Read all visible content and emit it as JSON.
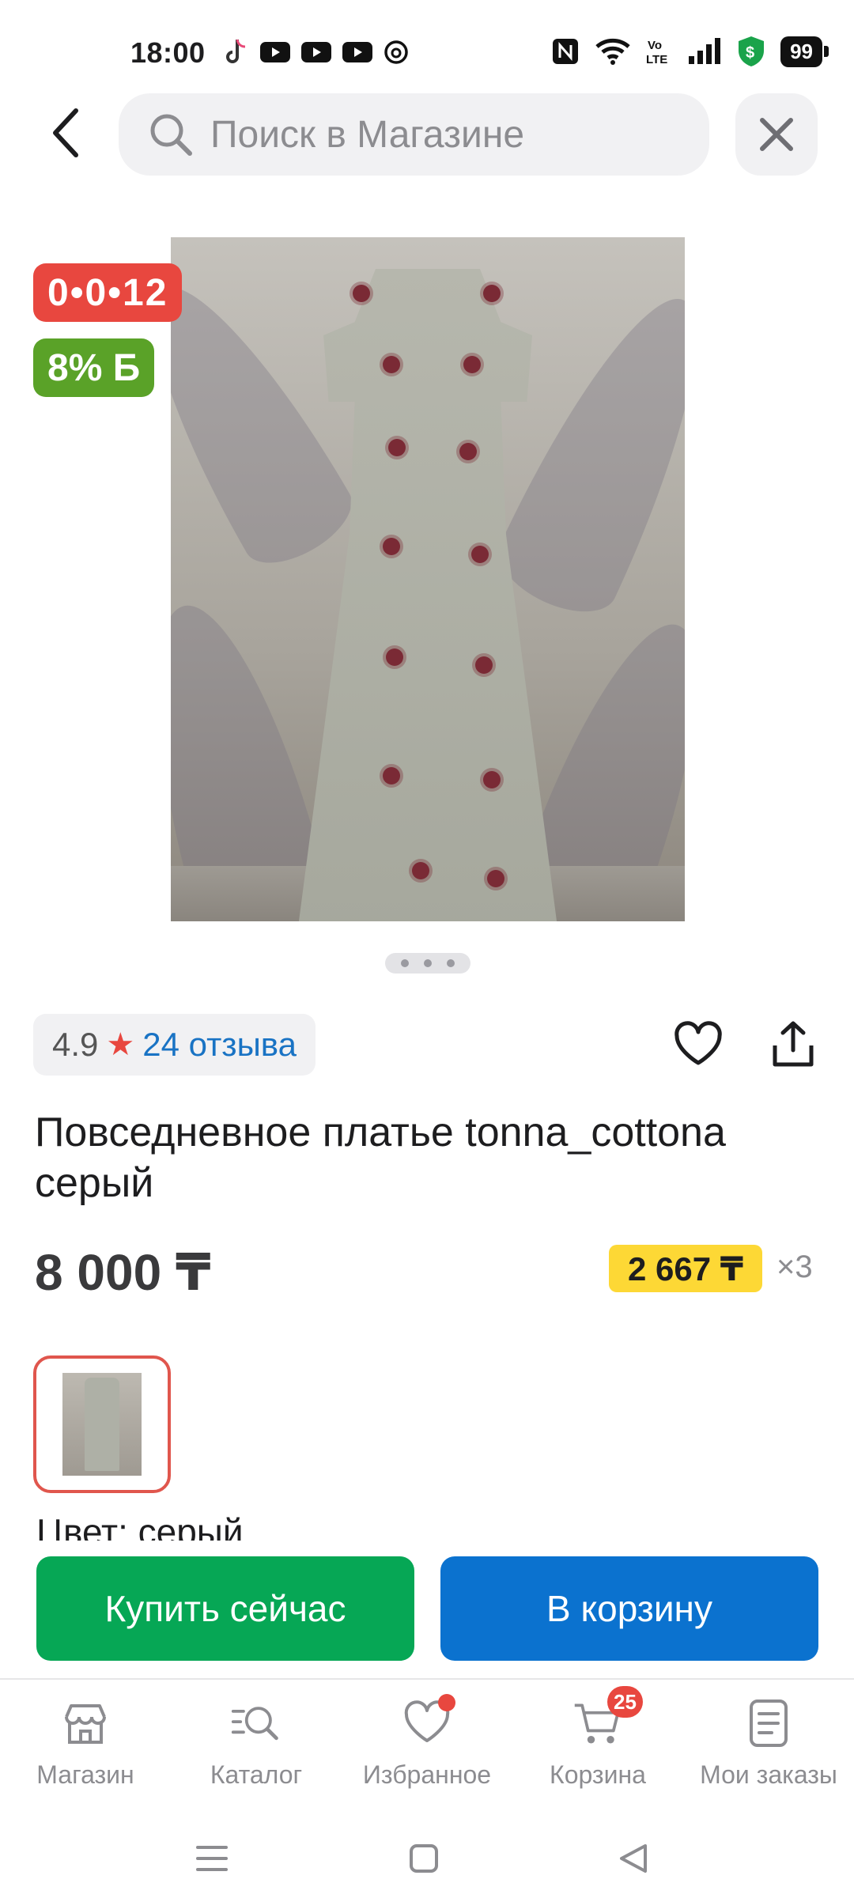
{
  "status_bar": {
    "time": "18:00",
    "battery": "99",
    "app_icons": [
      "tiktok-icon",
      "youtube-icon",
      "youtube-icon",
      "youtube-icon",
      "threads-icon"
    ],
    "right_icons": [
      "nfc-icon",
      "wifi-icon",
      "volte-icon",
      "signal-icon",
      "shield-dollar-icon",
      "battery-icon"
    ]
  },
  "header": {
    "search_placeholder": "Поиск в Магазине"
  },
  "product": {
    "timer": "0•0•12",
    "bonus": "8% Б",
    "image_count": 3,
    "active_image": 1,
    "rating": "4.9",
    "reviews": "24 отзыва",
    "title": "Повседневное платье tonna_cottona серый",
    "price": "8 000 ₸",
    "installment_price": "2 667 ₸",
    "installment_multiplier": "×3",
    "color_label": "Цвет: серый"
  },
  "actions": {
    "buy_now": "Купить сейчас",
    "add_to_cart": "В корзину"
  },
  "bottom_nav": {
    "items": [
      {
        "label": "Магазин",
        "icon": "store-icon"
      },
      {
        "label": "Каталог",
        "icon": "catalog-search-icon"
      },
      {
        "label": "Избранное",
        "icon": "heart-icon"
      },
      {
        "label": "Корзина",
        "icon": "cart-icon"
      },
      {
        "label": "Мои заказы",
        "icon": "orders-icon"
      }
    ],
    "cart_count": "25"
  },
  "colors": {
    "accent_red": "#e8473f",
    "bonus_green": "#5aa228",
    "buy_green": "#06a755",
    "cart_blue": "#0b72cf",
    "installment_yellow": "#fdd835",
    "link_blue": "#1973c4"
  }
}
